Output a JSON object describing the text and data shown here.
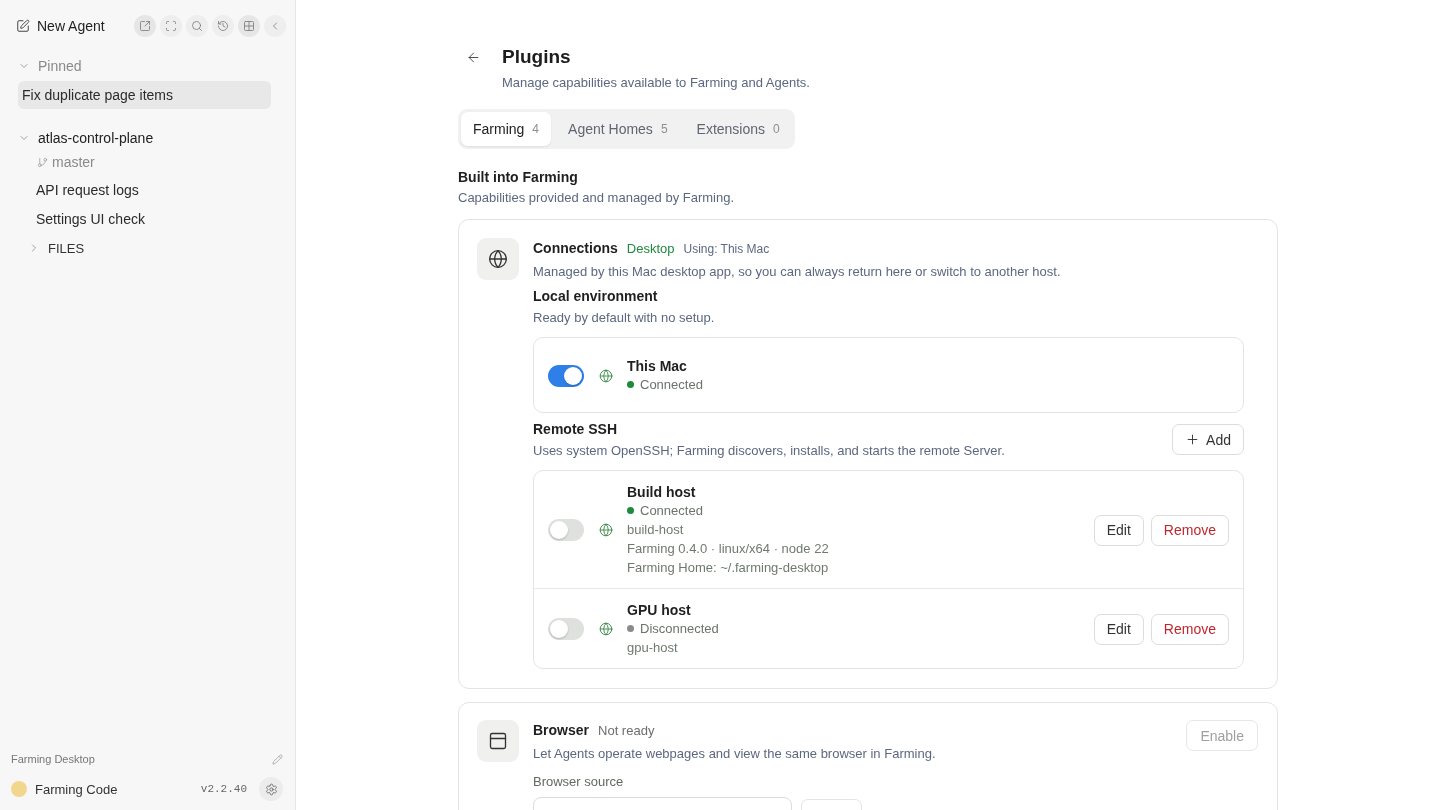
{
  "sidebar": {
    "new_agent": "New Agent",
    "pinned": {
      "label": "Pinned",
      "expanded": true,
      "items": [
        {
          "title": "Fix duplicate page items",
          "selected": true
        }
      ]
    },
    "project": {
      "name": "atlas-control-plane",
      "expanded": true,
      "branch": "master",
      "items": [
        {
          "title": "API request logs",
          "selected": false
        },
        {
          "title": "Settings UI check",
          "selected": false
        }
      ]
    },
    "files": {
      "label": "FILES",
      "expanded": false
    },
    "footer": {
      "workspace": "Farming Desktop",
      "app_name": "Farming Code",
      "version": "v2.2.40"
    }
  },
  "page": {
    "title": "Plugins",
    "subtitle": "Manage capabilities available to Farming and Agents."
  },
  "tabs": [
    {
      "label": "Farming",
      "count": "4",
      "selected": true
    },
    {
      "label": "Agent Homes",
      "count": "5",
      "selected": false
    },
    {
      "label": "Extensions",
      "count": "0",
      "selected": false
    }
  ],
  "section": {
    "title": "Built into Farming",
    "subtitle": "Capabilities provided and managed by Farming."
  },
  "plugins": [
    {
      "kind": "connections",
      "name": "Connections",
      "status": {
        "text": "Desktop",
        "ready": true
      },
      "using": "Using: This Mac",
      "description": "Managed by this Mac desktop app, so you can always return here or switch to another host.",
      "groups": [
        {
          "kind": "local",
          "title": "Local environment",
          "subtitle": "Ready by default with no setup.",
          "hosts": [
            {
              "name": "This Mac",
              "on": true,
              "status": "Connected",
              "connected": true
            }
          ]
        },
        {
          "kind": "remote",
          "title": "Remote SSH",
          "subtitle": "Uses system OpenSSH; Farming discovers, installs, and starts the remote Server.",
          "add_label": "Add",
          "hosts": [
            {
              "name": "Build host",
              "on": false,
              "status": "Connected",
              "connected": true,
              "details": [
                "build-host",
                "Farming 0.4.0 · linux/x64 · node 22",
                "Farming Home: ~/.farming-desktop"
              ],
              "actions": [
                {
                  "label": "Edit",
                  "kind": "default"
                },
                {
                  "label": "Remove",
                  "kind": "danger"
                }
              ]
            },
            {
              "name": "GPU host",
              "on": false,
              "status": "Disconnected",
              "connected": false,
              "details": [
                "gpu-host"
              ],
              "actions": [
                {
                  "label": "Edit",
                  "kind": "default"
                },
                {
                  "label": "Remove",
                  "kind": "danger"
                }
              ]
            }
          ]
        }
      ]
    },
    {
      "kind": "browser",
      "name": "Browser",
      "status": {
        "text": "Not ready",
        "ready": false
      },
      "description": "Let Agents operate webpages and view the same browser in Farming.",
      "action": {
        "label": "Enable",
        "disabled": true
      },
      "source_label": "Browser source"
    }
  ]
}
